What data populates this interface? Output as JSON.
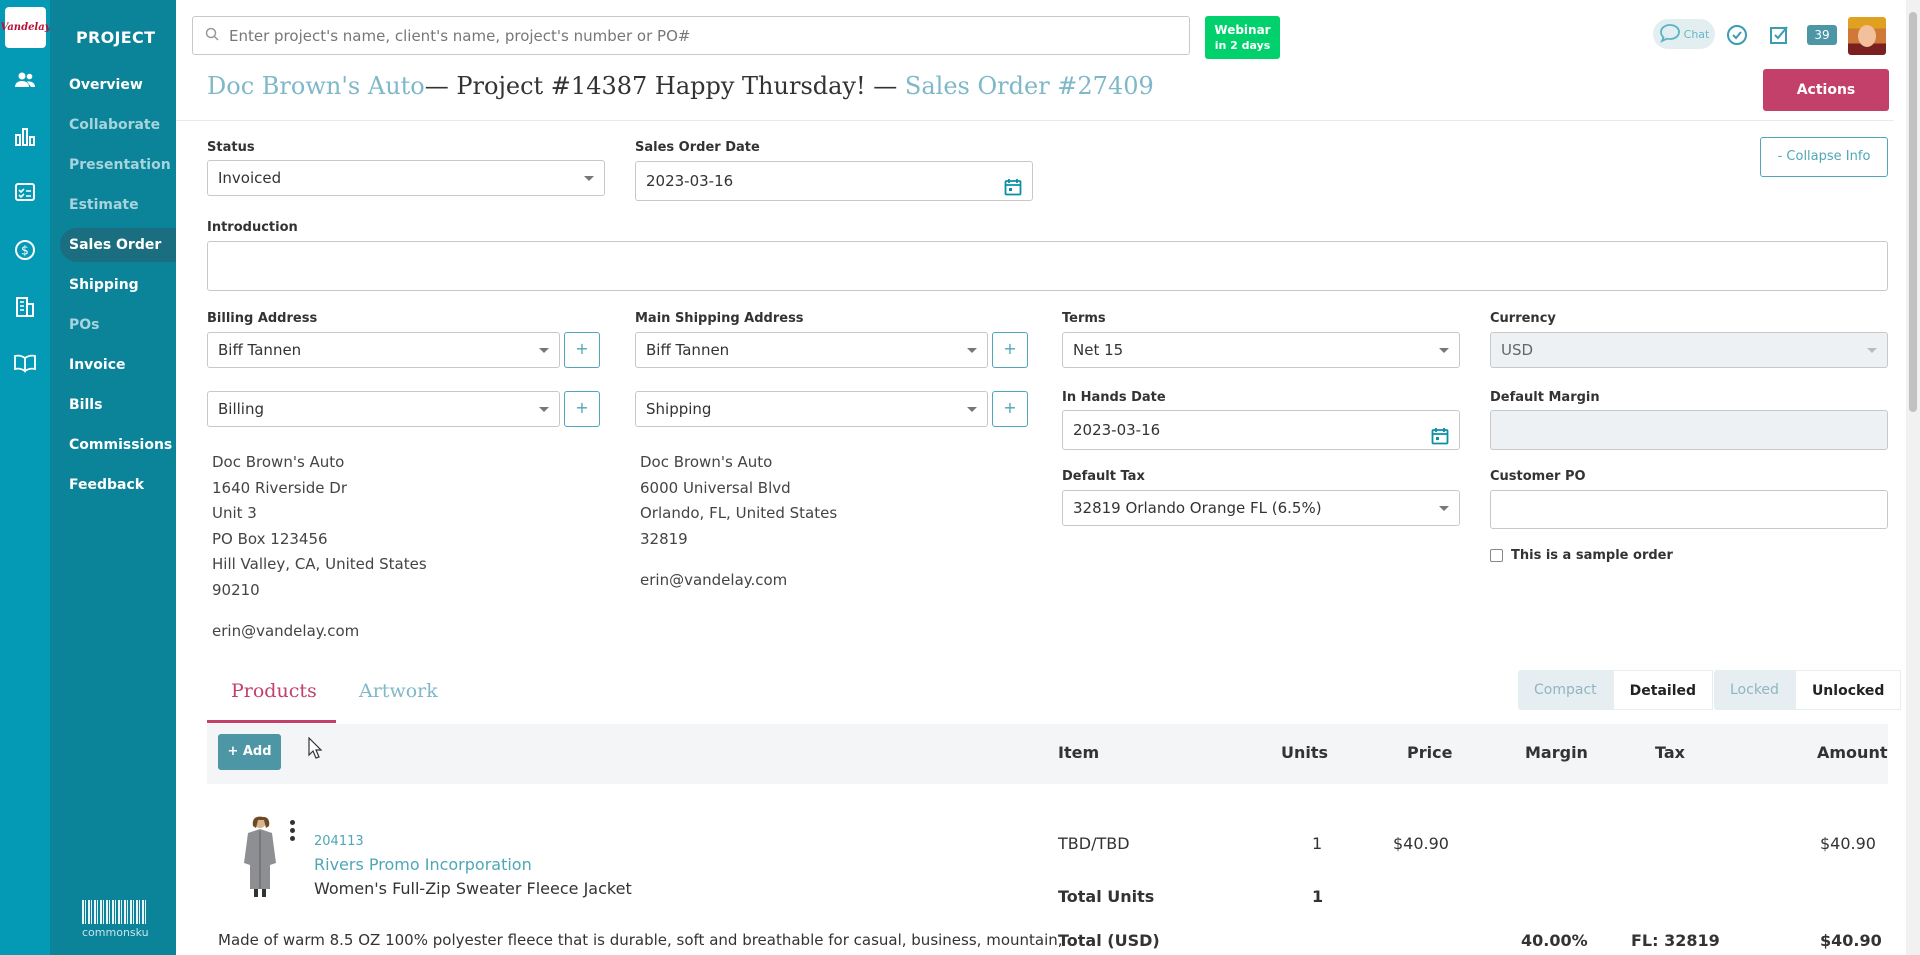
{
  "app": {
    "logo_text": "Vandelay",
    "section_title": "PROJECT",
    "footer_brand": "commonsku"
  },
  "sidebar": {
    "items": [
      {
        "label": "Overview",
        "state": "enabled"
      },
      {
        "label": "Collaborate",
        "state": "dim"
      },
      {
        "label": "Presentation",
        "state": "dim"
      },
      {
        "label": "Estimate",
        "state": "dim"
      },
      {
        "label": "Sales Order",
        "state": "active"
      },
      {
        "label": "Shipping",
        "state": "enabled"
      },
      {
        "label": "POs",
        "state": "dim"
      },
      {
        "label": "Invoice",
        "state": "enabled"
      },
      {
        "label": "Bills",
        "state": "enabled"
      },
      {
        "label": "Commissions",
        "state": "enabled"
      },
      {
        "label": "Feedback",
        "state": "enabled"
      }
    ]
  },
  "rail_icons": [
    "people-icon",
    "bar-chart-icon",
    "checklist-icon",
    "dollar-icon",
    "building-icon",
    "book-icon"
  ],
  "topbar": {
    "search_placeholder": "Enter project's name, client's name, project's number or PO#",
    "webinar_title": "Webinar",
    "webinar_sub": "in 2 days",
    "chat_label": "Chat",
    "notification_count": "39"
  },
  "header": {
    "client": "Doc Brown's Auto",
    "project": "— Project #14387 Happy Thursday! —",
    "sales_order": "Sales Order #27409",
    "actions_label": "Actions",
    "collapse_label": "- Collapse Info"
  },
  "form": {
    "status_label": "Status",
    "status_value": "Invoiced",
    "so_date_label": "Sales Order Date",
    "so_date_value": "2023-03-16",
    "intro_label": "Introduction",
    "intro_value": "",
    "billing_label": "Billing Address",
    "billing_contact": "Biff Tannen",
    "billing_type": "Billing",
    "shipping_label": "Main Shipping Address",
    "shipping_contact": "Biff Tannen",
    "shipping_type": "Shipping",
    "terms_label": "Terms",
    "terms_value": "Net 15",
    "currency_label": "Currency",
    "currency_value": "USD",
    "in_hands_label": "In Hands Date",
    "in_hands_value": "2023-03-16",
    "default_margin_label": "Default Margin",
    "default_margin_value": "",
    "default_tax_label": "Default Tax",
    "default_tax_value": "32819 Orlando Orange FL (6.5%)",
    "customer_po_label": "Customer PO",
    "customer_po_value": "",
    "sample_label": "This is a sample order",
    "plus_label": "+"
  },
  "billing_address": [
    "Doc Brown's Auto",
    "1640 Riverside Dr",
    "Unit 3",
    "PO Box 123456",
    "Hill Valley, CA, United States",
    "90210"
  ],
  "billing_email": "erin@vandelay.com",
  "shipping_address": [
    "Doc Brown's Auto",
    "6000 Universal Blvd",
    "Orlando, FL, United States",
    "32819"
  ],
  "shipping_email": "erin@vandelay.com",
  "tabs": {
    "products": "Products",
    "artwork": "Artwork"
  },
  "view_toggle": {
    "compact": "Compact",
    "detailed": "Detailed",
    "selected": "Detailed"
  },
  "lock_toggle": {
    "locked": "Locked",
    "unlocked": "Unlocked",
    "selected": "Unlocked"
  },
  "table": {
    "add_label": "+ Add",
    "headers": {
      "item": "Item",
      "units": "Units",
      "price": "Price",
      "margin": "Margin",
      "tax": "Tax",
      "amount": "Amount"
    },
    "product": {
      "sku": "204113",
      "supplier": "Rivers Promo Incorporation",
      "name": "Women's Full-Zip Sweater Fleece Jacket",
      "item": "TBD/TBD",
      "units": "1",
      "price": "$40.90",
      "amount": "$40.90",
      "total_units_label": "Total Units",
      "total_units": "1",
      "total_label": "Total (USD)",
      "margin": "40.00%",
      "tax": "FL: 32819",
      "total_amount": "$40.90",
      "description": "Made of warm 8.5 OZ 100% polyester fleece that is durable, soft and breathable for casual, business, mountain,"
    }
  },
  "colors": {
    "rail": "#049ab5",
    "sidebar": "#0b8398",
    "accent": "#c2406a",
    "link": "#7fb8c8",
    "webinar": "#00d16c"
  }
}
